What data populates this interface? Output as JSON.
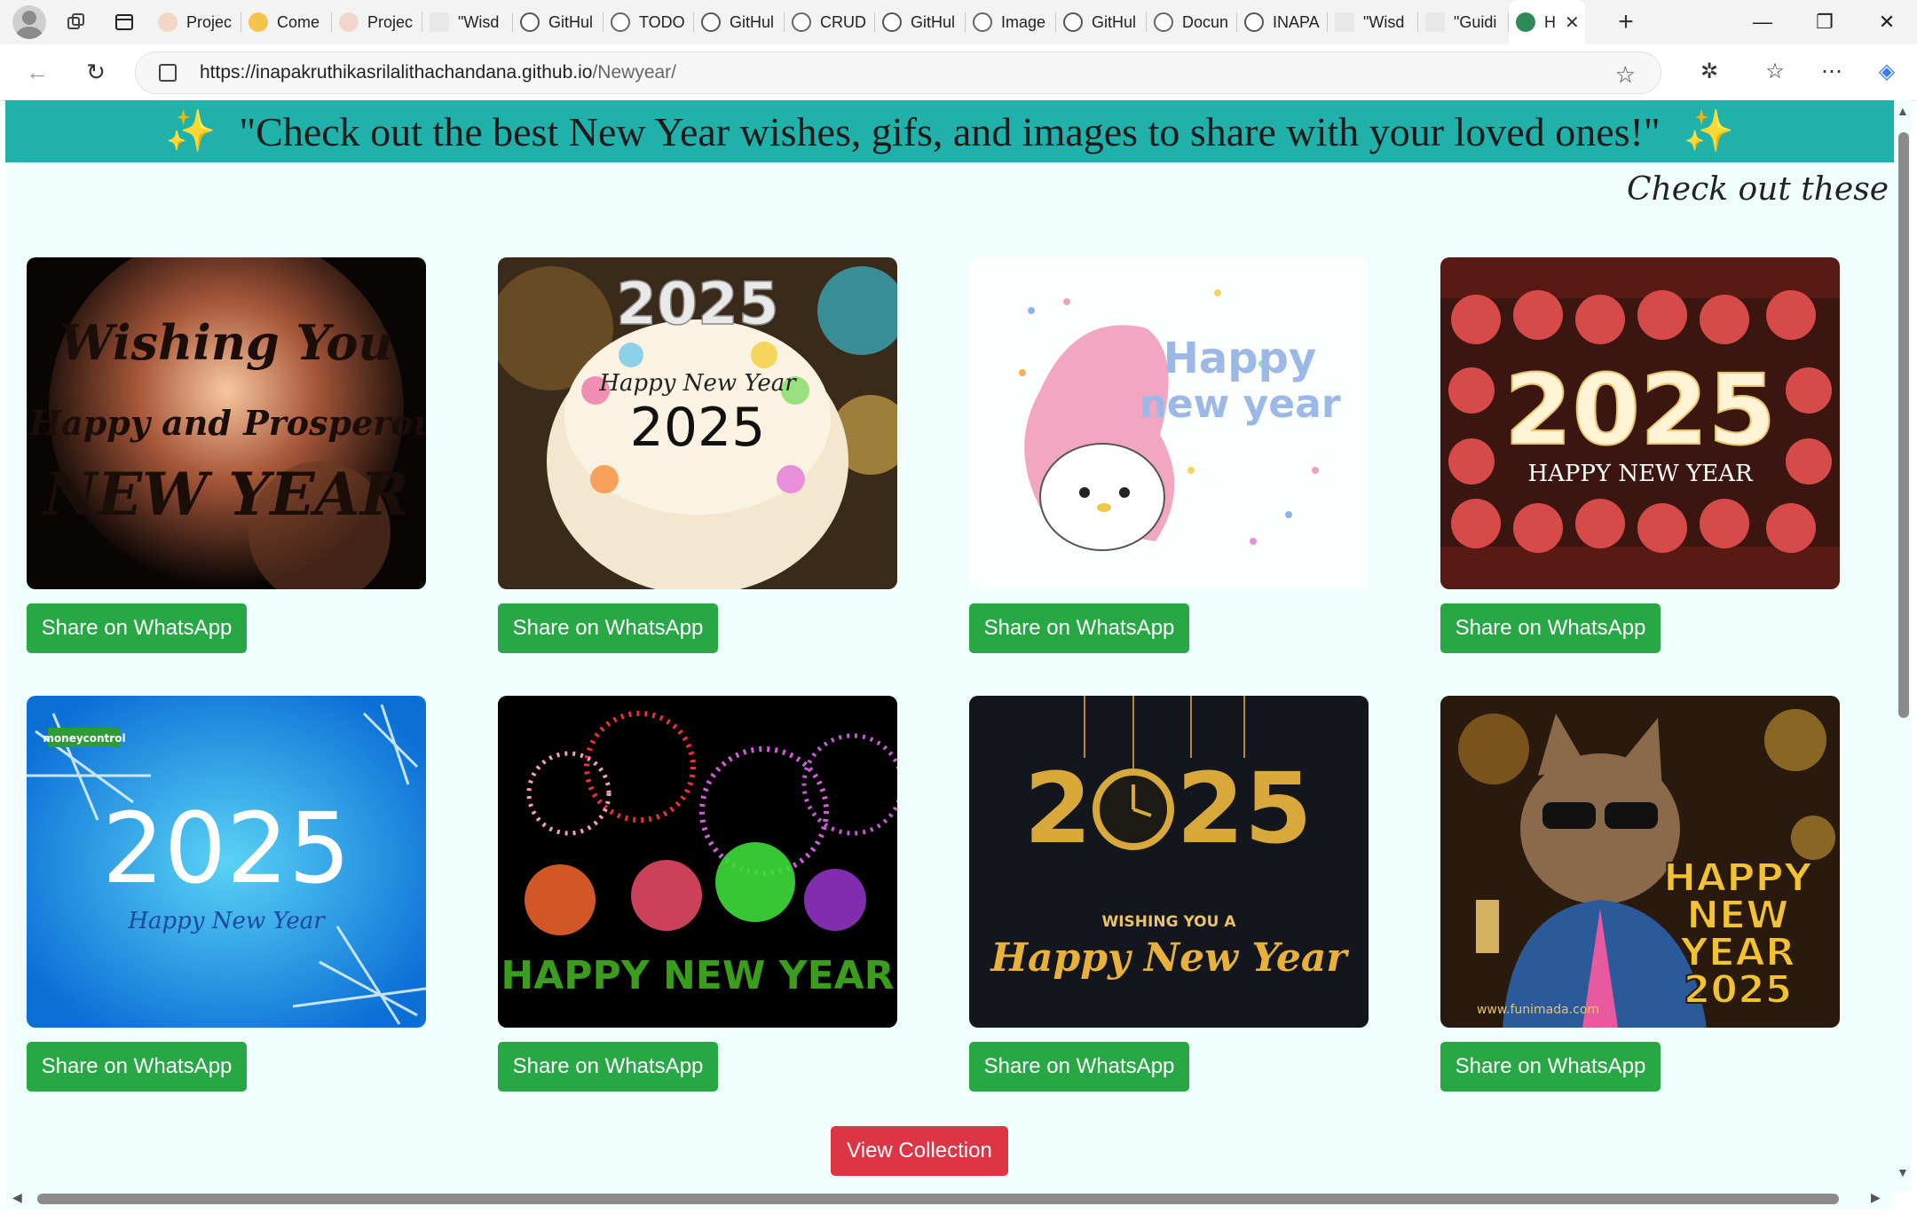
{
  "browser": {
    "tabs": [
      {
        "label": "Projec",
        "icon": "cup-icon"
      },
      {
        "label": "Come",
        "icon": "hands-icon"
      },
      {
        "label": "Projec",
        "icon": "cup-icon"
      },
      {
        "label": "\"Wisd",
        "icon": "wordpress-icon"
      },
      {
        "label": "GitHul",
        "icon": "github-icon"
      },
      {
        "label": "TODO",
        "icon": "globe-icon"
      },
      {
        "label": "GitHul",
        "icon": "github-icon"
      },
      {
        "label": "CRUD",
        "icon": "globe-icon"
      },
      {
        "label": "GitHul",
        "icon": "github-icon"
      },
      {
        "label": "Image",
        "icon": "globe-icon"
      },
      {
        "label": "GitHul",
        "icon": "github-icon"
      },
      {
        "label": "Docun",
        "icon": "globe-icon"
      },
      {
        "label": "INAPA",
        "icon": "github-icon"
      },
      {
        "label": "\"Wisd",
        "icon": "wordpress-icon"
      },
      {
        "label": "\"Guidi",
        "icon": "wordpress-icon"
      }
    ],
    "active_tab": {
      "label": "H",
      "icon": "tree-icon"
    },
    "url_host": "https://inapakruthikasrilalithachandana.github.io",
    "url_path": "/Newyear/"
  },
  "page": {
    "banner_text": "\"Check out the best New Year wishes, gifs, and images to share with your loved ones!\"",
    "banner_emoji": "✨",
    "marquee_text": "Check out these",
    "cards": [
      {
        "image_text": [
          "Wishing You",
          "a Happy and Prosperous",
          "NEW YEAR"
        ],
        "button": "Share on WhatsApp"
      },
      {
        "image_text": [
          "2025",
          "Happy New Year",
          "2025"
        ],
        "button": "Share on WhatsApp"
      },
      {
        "image_text": [
          "Happy",
          "new year"
        ],
        "button": "Share on WhatsApp"
      },
      {
        "image_text": [
          "2025",
          "HAPPY NEW YEAR"
        ],
        "button": "Share on WhatsApp"
      },
      {
        "image_text": [
          "moneycontrol",
          "2025",
          "Happy New Year"
        ],
        "button": "Share on WhatsApp"
      },
      {
        "image_text": [
          "HAPPY NEW YEAR"
        ],
        "button": "Share on WhatsApp"
      },
      {
        "image_text": [
          "2",
          "25",
          "WISHING YOU A",
          "Happy New Year"
        ],
        "button": "Share on WhatsApp"
      },
      {
        "image_text": [
          "HAPPY",
          "NEW",
          "YEAR",
          "2025",
          "www.funimada.com"
        ],
        "button": "Share on WhatsApp"
      }
    ],
    "view_button": "View Collection"
  },
  "colors": {
    "banner": "#20b2aa",
    "page_bg": "#f0fffe",
    "share_button": "#28a745",
    "view_button": "#dc3545"
  }
}
